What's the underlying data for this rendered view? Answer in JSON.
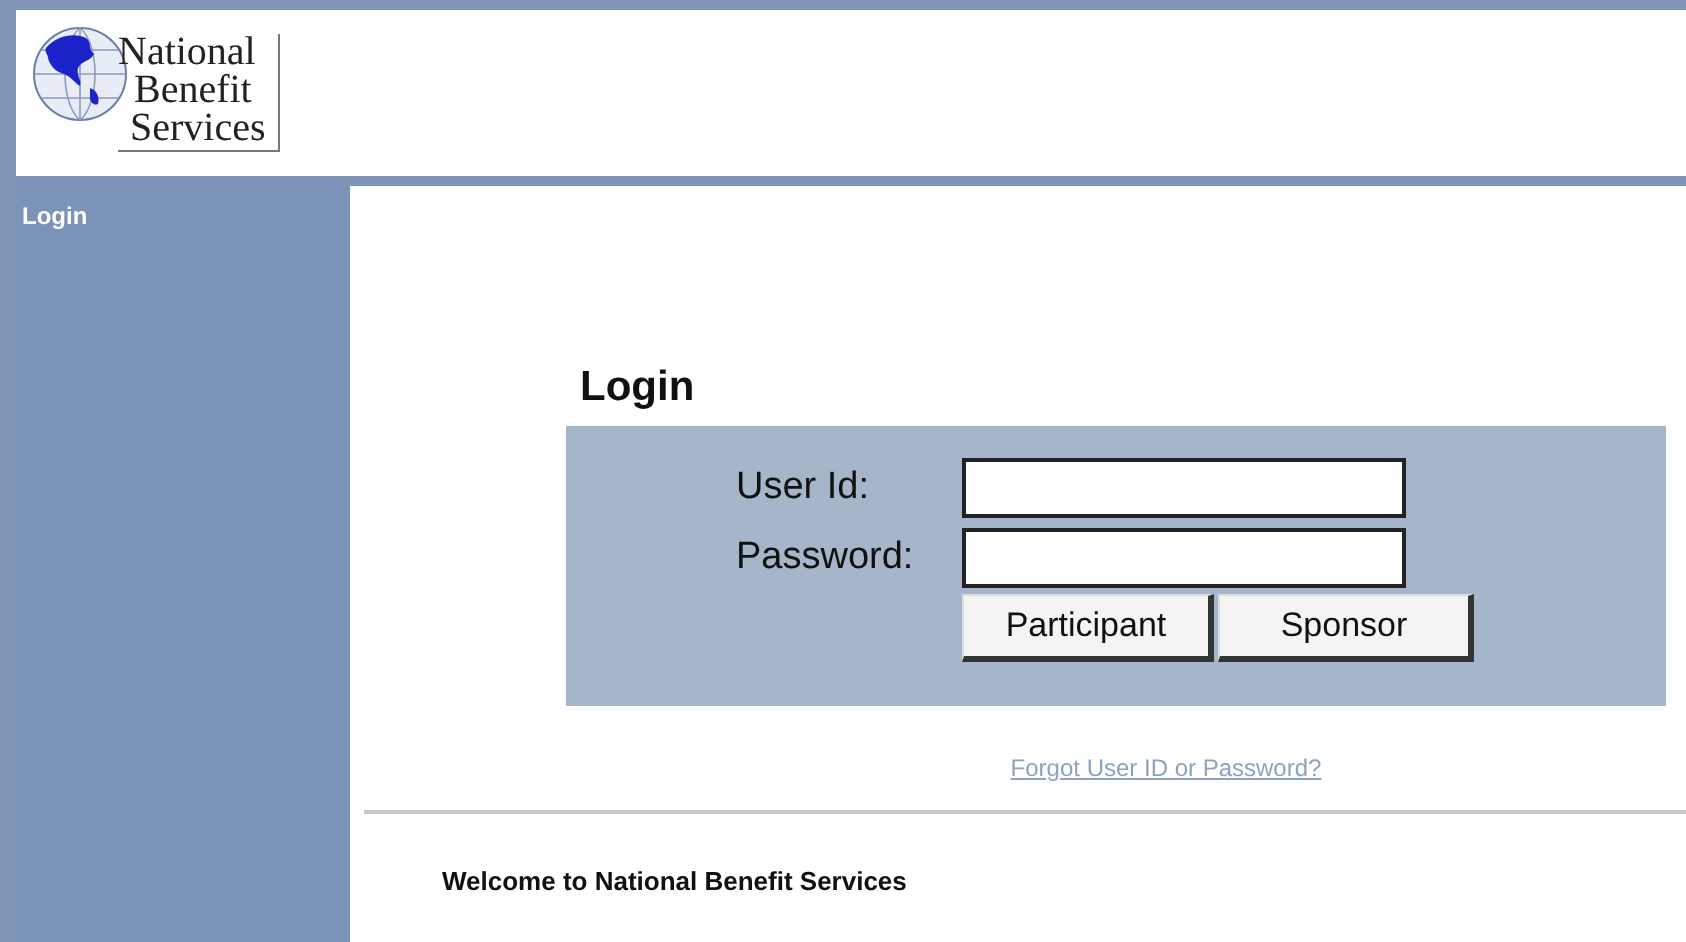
{
  "logo": {
    "lines": [
      "National",
      "Benefit",
      "Services"
    ]
  },
  "sidebar": {
    "items": [
      {
        "label": "Login"
      }
    ]
  },
  "login": {
    "title": "Login",
    "fields": [
      {
        "label": "User Id:"
      },
      {
        "label": "Password:"
      }
    ],
    "buttons": [
      "Participant",
      "Sponsor"
    ],
    "forgot_link": "Forgot User ID or Password?"
  },
  "welcome": "Welcome to National Benefit Services"
}
